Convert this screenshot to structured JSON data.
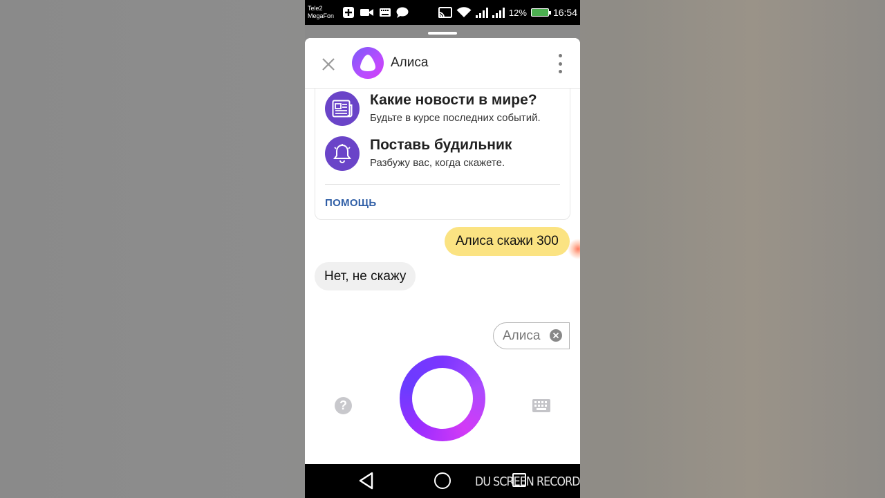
{
  "status_bar": {
    "carrier_line1": "Tele2",
    "carrier_line2": "MegaFon",
    "battery_percent": "12%",
    "time": "16:54"
  },
  "header": {
    "title": "Алиса"
  },
  "suggestions": [
    {
      "title": "Какие новости в мире?",
      "subtitle": "Будьте в курсе последних событий.",
      "icon": "newspaper-icon"
    },
    {
      "title": "Поставь будильник",
      "subtitle": "Разбужу вас, когда скажете.",
      "icon": "bell-icon"
    }
  ],
  "help_link": "ПОМОЩЬ",
  "chat": {
    "user_message": "Алиса скажи 300",
    "bot_message": "Нет, не скажу"
  },
  "chip": {
    "label": "Алиса"
  },
  "watermark": "DU SCREEN RECORDER",
  "colors": {
    "accent_purple": "#6a44c8",
    "user_bubble": "#fbe382",
    "bot_bubble": "#f0f0f0",
    "link_blue": "#2f5ea6"
  }
}
